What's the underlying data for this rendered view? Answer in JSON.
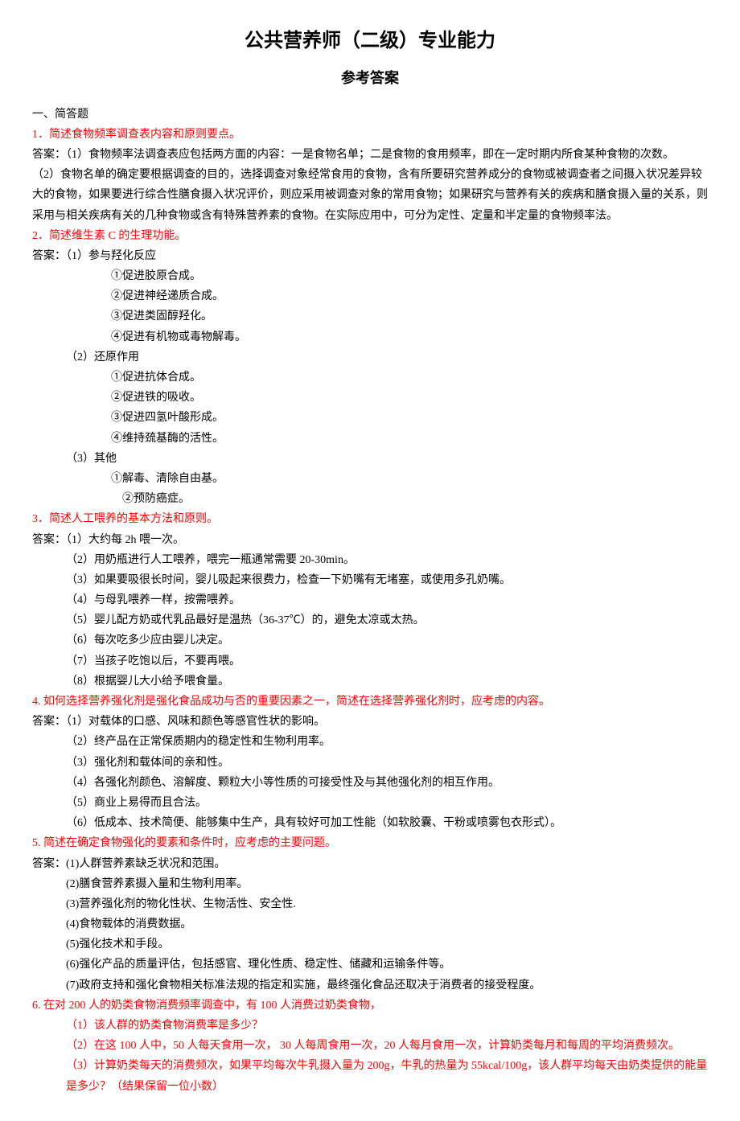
{
  "title": "公共营养师（二级）专业能力",
  "subtitle": "参考答案",
  "section1": "一、简答题",
  "q1": {
    "title": "1．简述食物频率调查表内容和原则要点。",
    "a1": "答案：（1）食物频率法调查表应包括两方面的内容：一是食物名单；二是食物的食用频率，即在一定时期内所食某种食物的次数。",
    "a2": "（2）食物名单的确定要根据调查的目的，选择调查对象经常食用的食物，含有所要研究营养成分的食物或被调查者之间摄入状况差异较大的食物，如果要进行综合性膳食摄入状况评价，则应采用被调查对象的常用食物；如果研究与营养有关的疾病和膳食摄入量的关系，则采用与相关疾病有关的几种食物或含有特殊营养素的食物。在实际应用中，可分为定性、定量和半定量的食物频率法。"
  },
  "q2": {
    "title": "2．简述维生素 C 的生理功能。",
    "a0": "答案：（1）参与羟化反应",
    "a1": "①促进胶原合成。",
    "a2": "②促进神经递质合成。",
    "a3": "③促进类固醇羟化。",
    "a4": "④促进有机物或毒物解毒。",
    "b0": "（2）还原作用",
    "b1": "①促进抗体合成。",
    "b2": "②促进铁的吸收。",
    "b3": "③促进四氢叶酸形成。",
    "b4": "④维持巯基酶的活性。",
    "c0": "（3）其他",
    "c1": "①解毒、清除自由基。",
    "c2": "②预防癌症。"
  },
  "q3": {
    "title": "3．简述人工喂养的基本方法和原则。",
    "a1": "答案：（1）大约每 2h 喂一次。",
    "a2": "（2）用奶瓶进行人工喂养，喂完一瓶通常需要 20-30min。",
    "a3": "（3）如果要吸很长时间，婴儿吸起来很费力，检查一下奶嘴有无堵塞，或使用多孔奶嘴。",
    "a4": "（4）与母乳喂养一样，按需喂养。",
    "a5": "（5）婴儿配方奶或代乳品最好是温热（36-37℃）的，避免太凉或太热。",
    "a6": "（6）每次吃多少应由婴儿决定。",
    "a7": "（7）当孩子吃饱以后，不要再喂。",
    "a8": "（8）根据婴儿大小给予喂食量。"
  },
  "q4": {
    "title": "4. 如何选择营养强化剂是强化食品成功与否的重要因素之一，简述在选择营养强化剂时，应考虑的内容。",
    "a1": "答案：（1）对载体的口感、风味和颜色等感官性状的影响。",
    "a2": "（2）终产品在正常保质期内的稳定性和生物利用率。",
    "a3": "（3）强化剂和载体间的亲和性。",
    "a4": "（4）各强化剂颜色、溶解度、颗粒大小等性质的可接受性及与其他强化剂的相互作用。",
    "a5": "（5）商业上易得而且合法。",
    "a6": "（6）低成本、技术简便、能够集中生产，具有较好可加工性能（如软胶囊、干粉或喷雾包衣形式）。"
  },
  "q5": {
    "title": "5. 简述在确定食物强化的要素和条件时，应考虑的主要问题。",
    "a1": "答案：(1)人群营养素缺乏状况和范围。",
    "a2": "(2)膳食营养素摄入量和生物利用率。",
    "a3": "(3)营养强化剂的物化性状、生物活性、安全性.",
    "a4": "(4)食物载体的消费数据。",
    "a5": "(5)强化技术和手段。",
    "a6": "(6)强化产品的质量评估，包括感官、理化性质、稳定性、储藏和运输条件等。",
    "a7": "(7)政府支持和强化食物相关标准法规的指定和实施，最终强化食品还取决于消费者的接受程度。"
  },
  "q6": {
    "title": "6. 在对 200 人的奶类食物消费频率调查中，有 100 人消费过奶类食物，",
    "a1": "（1）该人群的奶类食物消费率是多少？",
    "a2": "（2）在这 100 人中，50 人每天食用一次， 30 人每周食用一次，20 人每月食用一次，计算奶类每月和每周的平均消费频次。",
    "a3": "（3）计算奶类每天的消费频次，如果平均每次牛乳摄入量为 200g，牛乳的热量为 55kcal/100g，该人群平均每天由奶类提供的能量是多少？（结果保留一位小数）"
  }
}
